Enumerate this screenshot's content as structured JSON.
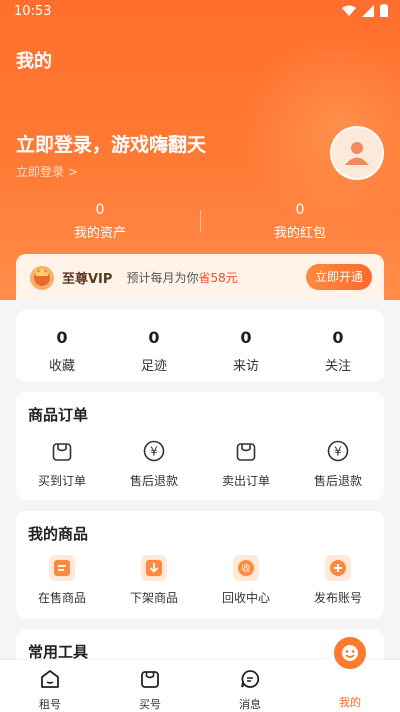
{
  "status": {
    "time": "10:53"
  },
  "header": {
    "title": "我的",
    "slogan": "立即登录，游戏嗨翻天",
    "login_link": "立即登录 >"
  },
  "assets": [
    {
      "value": "0",
      "label": "我的资产"
    },
    {
      "value": "0",
      "label": "我的红包"
    }
  ],
  "vip": {
    "name": "至尊VIP",
    "desc_prefix": "预计每月为你",
    "desc_save": "省58元",
    "button": "立即开通"
  },
  "stats": [
    {
      "value": "0",
      "label": "收藏"
    },
    {
      "value": "0",
      "label": "足迹"
    },
    {
      "value": "0",
      "label": "来访"
    },
    {
      "value": "0",
      "label": "关注"
    }
  ],
  "orders": {
    "title": "商品订单",
    "items": [
      {
        "label": "买到订单",
        "icon": "bag-icon"
      },
      {
        "label": "售后退款",
        "icon": "yen-icon"
      },
      {
        "label": "卖出订单",
        "icon": "bag-icon"
      },
      {
        "label": "售后退款",
        "icon": "yen-icon"
      }
    ]
  },
  "goods": {
    "title": "我的商品",
    "items": [
      {
        "label": "在售商品",
        "icon": "on-sale-icon"
      },
      {
        "label": "下架商品",
        "icon": "off-shelf-icon"
      },
      {
        "label": "回收中心",
        "icon": "recycle-icon"
      },
      {
        "label": "发布账号",
        "icon": "publish-icon"
      }
    ]
  },
  "tools": {
    "title": "常用工具"
  },
  "tabbar": [
    {
      "label": "租号",
      "icon": "home-icon"
    },
    {
      "label": "买号",
      "icon": "bag-icon"
    },
    {
      "label": "消息",
      "icon": "message-icon"
    },
    {
      "label": "我的",
      "icon": "smile-icon"
    }
  ],
  "colors": {
    "accent": "#ff6a2a",
    "hero": "#ff7a35",
    "save": "#f24b2e"
  }
}
